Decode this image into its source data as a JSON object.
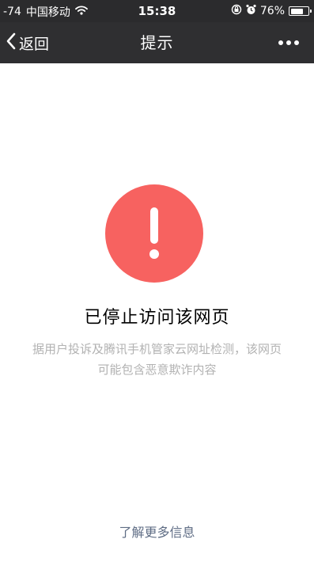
{
  "status_bar": {
    "signal": "-74",
    "carrier": "中国移动",
    "wifi_icon": "wifi-icon",
    "time": "15:38",
    "lock_icon": "orientation-lock-icon",
    "alarm_icon": "alarm-icon",
    "battery_text": "76%",
    "battery_level": 0.76
  },
  "nav": {
    "back_label": "返回",
    "title": "提示",
    "more_icon": "more-dots-icon"
  },
  "warning": {
    "icon": "exclamation-icon",
    "color": "#f76260",
    "title": "已停止访问该网页",
    "description_line1": "据用户投诉及腾讯手机管家云网址检测，该网页",
    "description_line2": "可能包含恶意欺诈内容"
  },
  "footer": {
    "learn_more": "了解更多信息"
  }
}
